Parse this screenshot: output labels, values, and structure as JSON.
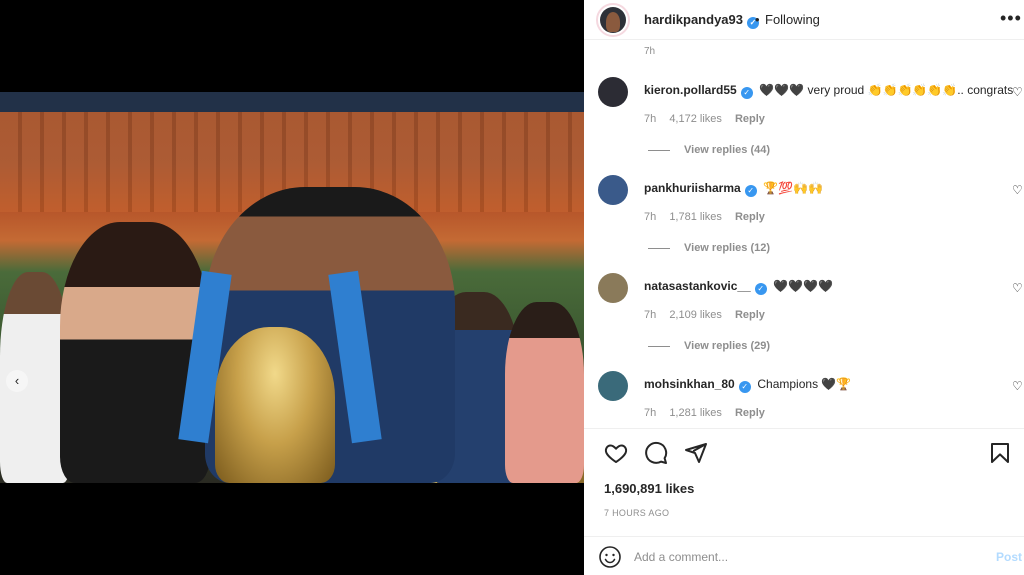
{
  "post": {
    "username": "hardikpandya93",
    "separator": "•",
    "follow_status": "Following",
    "more_label": "•••",
    "partial_time": "7h"
  },
  "comments": [
    {
      "username": "kieron.pollard55",
      "text": "🖤🖤🖤 very proud 👏👏👏👏👏👏.. congrats",
      "time": "7h",
      "likes": "4,172 likes",
      "reply": "Reply",
      "view_replies": "View replies (44)",
      "verified": true,
      "avatar_color": "#2c2c34"
    },
    {
      "username": "pankhuriisharma",
      "text": "🏆💯🙌🙌",
      "time": "7h",
      "likes": "1,781 likes",
      "reply": "Reply",
      "view_replies": "View replies (12)",
      "verified": true,
      "avatar_color": "#3a5a8a"
    },
    {
      "username": "natasastankovic__",
      "text": "🖤🖤🖤🖤",
      "time": "7h",
      "likes": "2,109 likes",
      "reply": "Reply",
      "view_replies": "View replies (29)",
      "verified": true,
      "avatar_color": "#8a7a5a"
    },
    {
      "username": "mohsinkhan_80",
      "text": "Champions 🖤🏆",
      "time": "7h",
      "likes": "1,281 likes",
      "reply": "Reply",
      "view_replies": "",
      "verified": true,
      "avatar_color": "#3a6a7a"
    }
  ],
  "actions": {
    "likes": "1,690,891 likes",
    "time_ago": "7 HOURS AGO"
  },
  "comment_box": {
    "placeholder": "Add a comment...",
    "post_label": "Post"
  },
  "carousel": {
    "prev_glyph": "‹"
  },
  "colors": {
    "verified": "#3897f0",
    "post_disabled": "#b3dbff",
    "meta": "#8e8e8e",
    "text": "#262626"
  },
  "icons": [
    "heart-icon",
    "comment-icon",
    "share-icon",
    "bookmark-icon",
    "emoji-icon",
    "verified-icon",
    "more-icon"
  ]
}
